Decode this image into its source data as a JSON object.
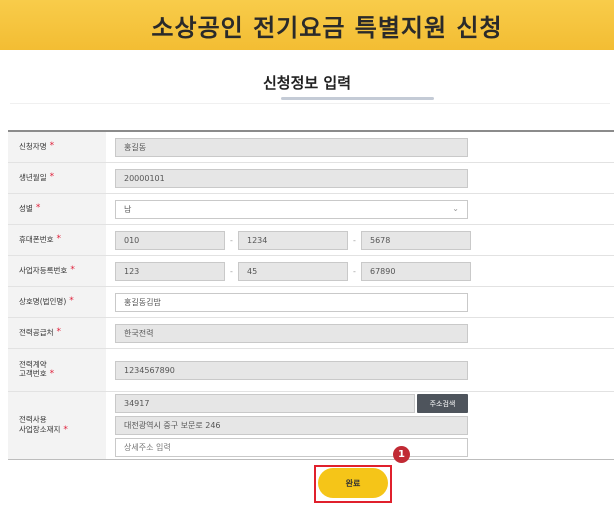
{
  "header": {
    "title": "소상공인 전기요금 특별지원 신청"
  },
  "section": {
    "title": "신청정보 입력"
  },
  "form": {
    "applicant_name": {
      "label": "신청자명",
      "value": "홍길동"
    },
    "birthdate": {
      "label": "생년월일",
      "value": "20000101"
    },
    "gender": {
      "label": "성별",
      "value": "남"
    },
    "phone": {
      "label": "휴대폰번호",
      "part1": "010",
      "part2": "1234",
      "part3": "5678"
    },
    "business_number": {
      "label": "사업자등록번호",
      "part1": "123",
      "part2": "45",
      "part3": "67890"
    },
    "company_name": {
      "label": "상호명(법인명)",
      "value": "홍길동김밥"
    },
    "power_supplier": {
      "label": "전력공급처",
      "value": "한국전력"
    },
    "contract_number": {
      "label_line1": "전력계약",
      "label_line2": "고객번호",
      "value": "1234567890"
    },
    "address": {
      "label_line1": "전력사용",
      "label_line2": "사업장소재지",
      "zipcode": "34917",
      "search_button": "주소검색",
      "street": "대전광역시 중구 보문로 246",
      "detail_placeholder": "상세주소 입력"
    },
    "required_mark": "*"
  },
  "submit": {
    "label": "완료"
  },
  "annotation": {
    "number": "1"
  }
}
